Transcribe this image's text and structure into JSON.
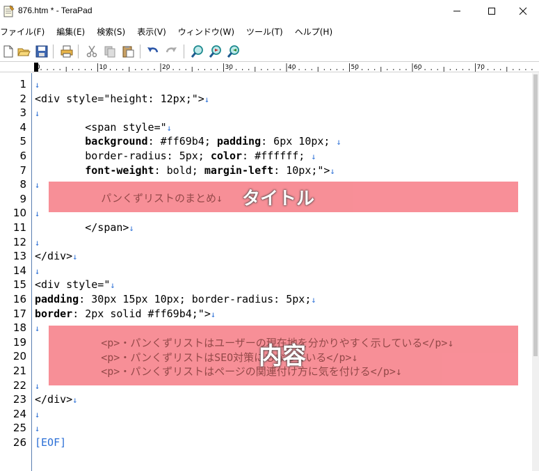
{
  "window": {
    "title": "876.htm * - TeraPad",
    "icon": "notepad-icon",
    "buttons": [
      "minimize-icon",
      "maximize-icon",
      "close-icon"
    ]
  },
  "menu": {
    "items": [
      "ファイル(F)",
      "編集(E)",
      "検索(S)",
      "表示(V)",
      "ウィンドウ(W)",
      "ツール(T)",
      "ヘルプ(H)"
    ]
  },
  "toolbar": {
    "icons": [
      "new-file-icon",
      "open-folder-icon",
      "save-icon",
      "print-icon",
      "cut-icon",
      "copy-icon",
      "paste-icon",
      "undo-icon",
      "redo-icon",
      "find-icon",
      "find-next-icon",
      "find-previous-icon"
    ]
  },
  "ruler": {
    "labels": [
      "0",
      "10",
      "20",
      "30",
      "40",
      "50",
      "60",
      "70"
    ]
  },
  "editor": {
    "lines": [
      {
        "n": "1",
        "parts": [],
        "eol": "↓"
      },
      {
        "n": "2",
        "parts": [
          {
            "t": "<div style=\"height: 12px;\">"
          }
        ],
        "eol": "↓"
      },
      {
        "n": "3",
        "parts": [],
        "eol": "↓"
      },
      {
        "n": "4",
        "parts": [
          {
            "t": "        <span style=\""
          }
        ],
        "eol": "↓"
      },
      {
        "n": "5",
        "parts": [
          {
            "t": "        "
          },
          {
            "t": "background",
            "b": true
          },
          {
            "t": ": #ff69b4; "
          },
          {
            "t": "padding",
            "b": true
          },
          {
            "t": ": 6px 10px; "
          }
        ],
        "eol": "↓"
      },
      {
        "n": "6",
        "parts": [
          {
            "t": "        border-radius: 5px; "
          },
          {
            "t": "color",
            "b": true
          },
          {
            "t": ": #ffffff; "
          }
        ],
        "eol": "↓"
      },
      {
        "n": "7",
        "parts": [
          {
            "t": "        "
          },
          {
            "t": "font-weight",
            "b": true
          },
          {
            "t": ": bold; "
          },
          {
            "t": "margin-left",
            "b": true
          },
          {
            "t": ": 10px;\">"
          }
        ],
        "eol": "↓"
      },
      {
        "n": "8",
        "parts": [],
        "eol": "↓"
      },
      {
        "n": "9",
        "parts": [],
        "eol": ""
      },
      {
        "n": "10",
        "parts": [],
        "eol": "↓"
      },
      {
        "n": "11",
        "parts": [
          {
            "t": "        </span>"
          }
        ],
        "eol": "↓"
      },
      {
        "n": "12",
        "parts": [],
        "eol": "↓"
      },
      {
        "n": "13",
        "parts": [
          {
            "t": "</div>"
          }
        ],
        "eol": "↓"
      },
      {
        "n": "14",
        "parts": [],
        "eol": "↓"
      },
      {
        "n": "15",
        "parts": [
          {
            "t": "<div style=\""
          }
        ],
        "eol": "↓"
      },
      {
        "n": "16",
        "parts": [
          {
            "t": "padding",
            "b": true
          },
          {
            "t": ": 30px 15px 10px; border-radius: 5px;"
          }
        ],
        "eol": "↓"
      },
      {
        "n": "17",
        "parts": [
          {
            "t": "border",
            "b": true
          },
          {
            "t": ": 2px solid #ff69b4;\">"
          }
        ],
        "eol": "↓"
      },
      {
        "n": "18",
        "parts": [],
        "eol": "↓"
      },
      {
        "n": "19",
        "parts": [],
        "eol": ""
      },
      {
        "n": "20",
        "parts": [],
        "eol": ""
      },
      {
        "n": "21",
        "parts": [],
        "eol": ""
      },
      {
        "n": "22",
        "parts": [],
        "eol": "↓"
      },
      {
        "n": "23",
        "parts": [
          {
            "t": "</div>"
          }
        ],
        "eol": "↓"
      },
      {
        "n": "24",
        "parts": [],
        "eol": "↓"
      },
      {
        "n": "25",
        "parts": [],
        "eol": "↓"
      },
      {
        "n": "26",
        "parts": [],
        "eol": ""
      }
    ],
    "eof_marker": "[EOF]"
  },
  "highlights": {
    "title_box": {
      "label": "タイトル",
      "text": "        パンくずリストのまとめ↓",
      "color": "#f7868f"
    },
    "content_box": {
      "label": "内容",
      "lines": [
        "        <p>・パンくずリストはユーザーの現在地を分かりやすく示している</p>↓",
        "        <p>・パンくずリストはSEO対策にもなっている</p>↓",
        "        <p>・パンくずリストはページの関連付け方に気を付ける</p>↓"
      ],
      "color": "#f7868f"
    }
  },
  "colors": {
    "eol_mark": "#2b6fd6",
    "gutter_border": "#5a7fb0"
  }
}
